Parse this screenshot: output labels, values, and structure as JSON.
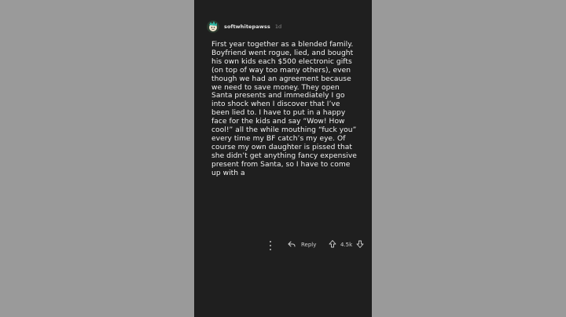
{
  "comment": {
    "username": "softwhitepawss",
    "age": "1d",
    "text": "First year together as a blended family. Boyfriend went rogue, lied, and bought his own kids each $500 electronic gifts (on top of way too many others), even though we had an agreement because we need to save money. They open Santa presents and immediately I go into shock when I discover that I’ve been lied to. I have to put in a happy face for the kids and say “Wow! How cool!” all the while mouthing “fuck you” every time my BF catch’s my eye. Of course my own daughter is pissed that she didn’t get anything fancy expensive present from Santa, so I have to come up with a"
  },
  "actions": {
    "reply_label": "Reply",
    "vote_count": "4.5k"
  },
  "icons": {
    "more": "more-options-icon",
    "reply": "reply-arrow-icon",
    "upvote": "upvote-arrow-icon",
    "downvote": "downvote-arrow-icon",
    "avatar": "user-avatar-icon"
  },
  "colors": {
    "panel_bg": "#1f1f1f",
    "page_bg": "#9a9a9a",
    "text": "#f2f2f2",
    "muted": "#8b8b8b"
  }
}
